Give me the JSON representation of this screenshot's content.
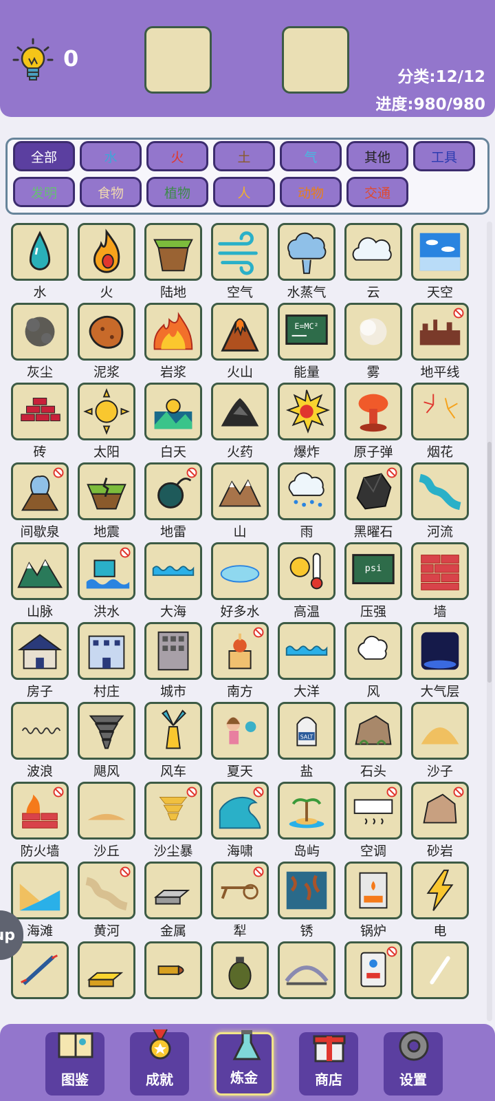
{
  "header": {
    "hint_count": "0",
    "category_stat": "分类:12/12",
    "progress_stat": "进度:980/980"
  },
  "filters": [
    {
      "label": "全部",
      "color": "#ffffff",
      "active": true
    },
    {
      "label": "水",
      "color": "#3fa6d8"
    },
    {
      "label": "火",
      "color": "#e0372e"
    },
    {
      "label": "土",
      "color": "#8a5a2b"
    },
    {
      "label": "气",
      "color": "#47b9e0"
    },
    {
      "label": "其他",
      "color": "#222222"
    },
    {
      "label": "工具",
      "color": "#2c3bb0"
    },
    {
      "label": "发明",
      "color": "#68bd76"
    },
    {
      "label": "食物",
      "color": "#f0d9b0"
    },
    {
      "label": "植物",
      "color": "#3d8a4a"
    },
    {
      "label": "人",
      "color": "#f0b030"
    },
    {
      "label": "动物",
      "color": "#e87f1c"
    },
    {
      "label": "交通",
      "color": "#e04a2e"
    }
  ],
  "items": [
    {
      "label": "水",
      "icon": "water-drop-icon"
    },
    {
      "label": "火",
      "icon": "flame-icon"
    },
    {
      "label": "陆地",
      "icon": "land-icon"
    },
    {
      "label": "空气",
      "icon": "wind-icon"
    },
    {
      "label": "水蒸气",
      "icon": "steam-icon"
    },
    {
      "label": "云",
      "icon": "cloud-icon"
    },
    {
      "label": "天空",
      "icon": "sky-icon"
    },
    {
      "label": "灰尘",
      "icon": "dust-icon"
    },
    {
      "label": "泥浆",
      "icon": "mud-icon"
    },
    {
      "label": "岩浆",
      "icon": "lava-icon"
    },
    {
      "label": "火山",
      "icon": "volcano-icon"
    },
    {
      "label": "能量",
      "icon": "energy-icon"
    },
    {
      "label": "雾",
      "icon": "fog-icon"
    },
    {
      "label": "地平线",
      "icon": "horizon-icon",
      "locked": true
    },
    {
      "label": "砖",
      "icon": "brick-icon"
    },
    {
      "label": "太阳",
      "icon": "sun-icon"
    },
    {
      "label": "白天",
      "icon": "daytime-icon"
    },
    {
      "label": "火药",
      "icon": "gunpowder-icon"
    },
    {
      "label": "爆炸",
      "icon": "explosion-icon"
    },
    {
      "label": "原子弹",
      "icon": "atomic-bomb-icon"
    },
    {
      "label": "烟花",
      "icon": "fireworks-icon"
    },
    {
      "label": "间歇泉",
      "icon": "geyser-icon",
      "locked": true
    },
    {
      "label": "地震",
      "icon": "earthquake-icon"
    },
    {
      "label": "地雷",
      "icon": "landmine-icon",
      "locked": true
    },
    {
      "label": "山",
      "icon": "mountain-icon"
    },
    {
      "label": "雨",
      "icon": "rain-icon"
    },
    {
      "label": "黑曜石",
      "icon": "obsidian-icon",
      "locked": true
    },
    {
      "label": "河流",
      "icon": "river-icon"
    },
    {
      "label": "山脉",
      "icon": "mountain-range-icon"
    },
    {
      "label": "洪水",
      "icon": "flood-icon",
      "locked": true
    },
    {
      "label": "大海",
      "icon": "sea-icon"
    },
    {
      "label": "好多水",
      "icon": "puddle-icon"
    },
    {
      "label": "高温",
      "icon": "heat-icon"
    },
    {
      "label": "压强",
      "icon": "pressure-icon"
    },
    {
      "label": "墙",
      "icon": "wall-icon"
    },
    {
      "label": "房子",
      "icon": "house-icon"
    },
    {
      "label": "村庄",
      "icon": "village-icon"
    },
    {
      "label": "城市",
      "icon": "city-icon"
    },
    {
      "label": "南方",
      "icon": "temple-icon",
      "locked": true
    },
    {
      "label": "大洋",
      "icon": "ocean-icon"
    },
    {
      "label": "风",
      "icon": "gust-icon"
    },
    {
      "label": "大气层",
      "icon": "atmosphere-icon"
    },
    {
      "label": "波浪",
      "icon": "wave-icon"
    },
    {
      "label": "飓风",
      "icon": "tornado-icon"
    },
    {
      "label": "风车",
      "icon": "windmill-icon"
    },
    {
      "label": "夏天",
      "icon": "summer-icon"
    },
    {
      "label": "盐",
      "icon": "salt-icon"
    },
    {
      "label": "石头",
      "icon": "stone-icon"
    },
    {
      "label": "沙子",
      "icon": "sand-icon"
    },
    {
      "label": "防火墙",
      "icon": "firewall-icon",
      "locked": true
    },
    {
      "label": "沙丘",
      "icon": "dune-icon"
    },
    {
      "label": "沙尘暴",
      "icon": "sandstorm-icon",
      "locked": true
    },
    {
      "label": "海啸",
      "icon": "tsunami-icon",
      "locked": true
    },
    {
      "label": "岛屿",
      "icon": "island-icon"
    },
    {
      "label": "空调",
      "icon": "air-conditioner-icon",
      "locked": true
    },
    {
      "label": "砂岩",
      "icon": "sandstone-icon",
      "locked": true
    },
    {
      "label": "海滩",
      "icon": "beach-icon"
    },
    {
      "label": "黄河",
      "icon": "yellow-river-icon",
      "locked": true
    },
    {
      "label": "金属",
      "icon": "metal-icon"
    },
    {
      "label": "犁",
      "icon": "plow-icon",
      "locked": true
    },
    {
      "label": "锈",
      "icon": "rust-icon"
    },
    {
      "label": "锅炉",
      "icon": "boiler-icon"
    },
    {
      "label": "电",
      "icon": "lightning-icon"
    },
    {
      "label": "",
      "icon": "wire-icon"
    },
    {
      "label": "",
      "icon": "gold-icon"
    },
    {
      "label": "",
      "icon": "bullet-icon"
    },
    {
      "label": "",
      "icon": "grenade-icon"
    },
    {
      "label": "",
      "icon": "bridge-icon"
    },
    {
      "label": "",
      "icon": "water-heater-icon",
      "locked": true
    },
    {
      "label": "",
      "icon": "chalk-icon"
    }
  ],
  "side_tab": "up",
  "nav": [
    {
      "label": "图鉴",
      "icon": "book-icon"
    },
    {
      "label": "成就",
      "icon": "medal-icon"
    },
    {
      "label": "炼金",
      "icon": "flask-icon",
      "active": true
    },
    {
      "label": "商店",
      "icon": "gift-icon"
    },
    {
      "label": "设置",
      "icon": "gear-icon"
    }
  ]
}
